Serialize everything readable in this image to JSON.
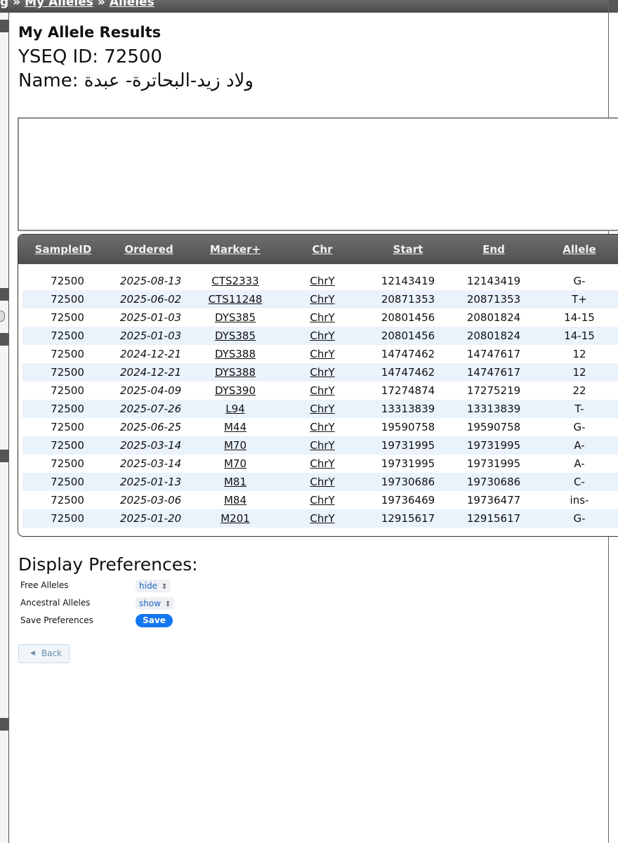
{
  "breadcrumb": {
    "partial": "g",
    "sep": "»",
    "items": [
      "My Alleles",
      "Alleles"
    ]
  },
  "header": {
    "title": "My Allele Results",
    "yseq_id": "YSEQ ID: 72500",
    "name_label": "Name:",
    "name_value": "ولاد زيد-البحاترة- عبدة"
  },
  "table": {
    "columns": [
      "SampleID",
      "Ordered",
      "Marker+",
      "Chr",
      "Start",
      "End",
      "Allele"
    ],
    "rows": [
      [
        "72500",
        "2025-08-13",
        "CTS2333",
        "ChrY",
        "12143419",
        "12143419",
        "G-"
      ],
      [
        "72500",
        "2025-06-02",
        "CTS11248",
        "ChrY",
        "20871353",
        "20871353",
        "T+"
      ],
      [
        "72500",
        "2025-01-03",
        "DYS385",
        "ChrY",
        "20801456",
        "20801824",
        "14-15"
      ],
      [
        "72500",
        "2025-01-03",
        "DYS385",
        "ChrY",
        "20801456",
        "20801824",
        "14-15"
      ],
      [
        "72500",
        "2024-12-21",
        "DYS388",
        "ChrY",
        "14747462",
        "14747617",
        "12"
      ],
      [
        "72500",
        "2024-12-21",
        "DYS388",
        "ChrY",
        "14747462",
        "14747617",
        "12"
      ],
      [
        "72500",
        "2025-04-09",
        "DYS390",
        "ChrY",
        "17274874",
        "17275219",
        "22"
      ],
      [
        "72500",
        "2025-07-26",
        "L94",
        "ChrY",
        "13313839",
        "13313839",
        "T-"
      ],
      [
        "72500",
        "2025-06-25",
        "M44",
        "ChrY",
        "19590758",
        "19590758",
        "G-"
      ],
      [
        "72500",
        "2025-03-14",
        "M70",
        "ChrY",
        "19731995",
        "19731995",
        "A-"
      ],
      [
        "72500",
        "2025-03-14",
        "M70",
        "ChrY",
        "19731995",
        "19731995",
        "A-"
      ],
      [
        "72500",
        "2025-01-13",
        "M81",
        "ChrY",
        "19730686",
        "19730686",
        "C-"
      ],
      [
        "72500",
        "2025-03-06",
        "M84",
        "ChrY",
        "19736469",
        "19736477",
        "ins-"
      ],
      [
        "72500",
        "2025-01-20",
        "M201",
        "ChrY",
        "12915617",
        "12915617",
        "G-"
      ]
    ]
  },
  "preferences": {
    "heading": "Display Preferences:",
    "free_label": "Free Alleles",
    "free_value": "hide",
    "ancestral_label": "Ancestral Alleles",
    "ancestral_value": "show",
    "save_label": "Save Preferences",
    "save_button": "Save"
  },
  "back_button": "Back",
  "colors": {
    "header_bg": "#5a5a5a",
    "alt_row": "#eaf2fb",
    "save_button": "#1377f0"
  }
}
